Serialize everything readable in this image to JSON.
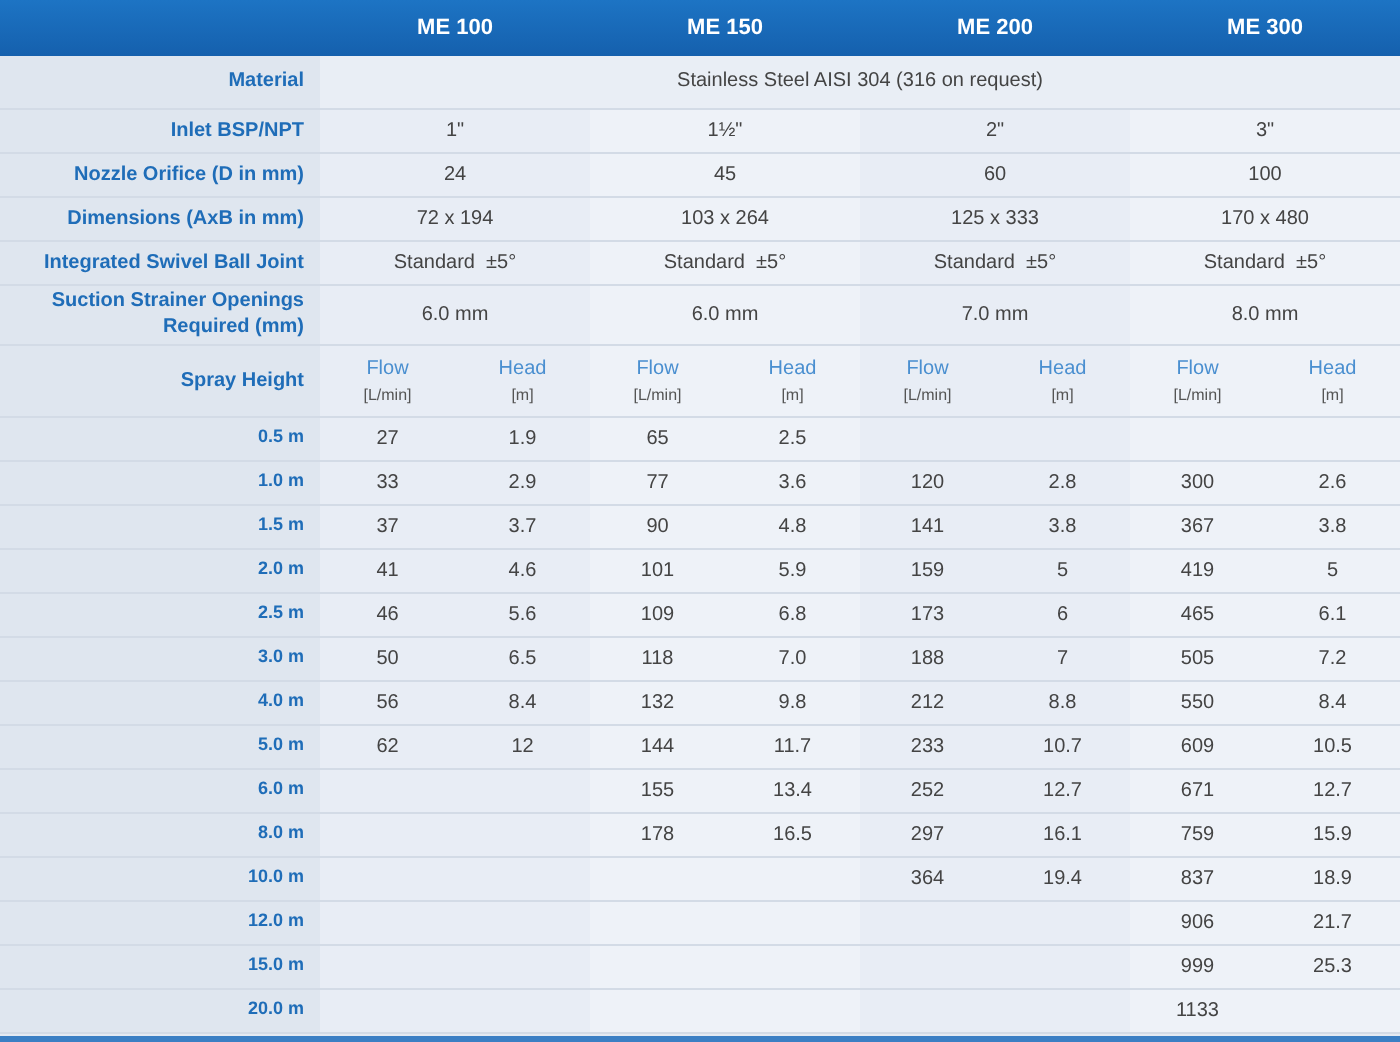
{
  "models": [
    "ME 100",
    "ME 150",
    "ME 200",
    "ME 300"
  ],
  "spec_rows": [
    {
      "label": "Material",
      "values": [
        "Stainless Steel AISI 304 (316 on request)"
      ]
    },
    {
      "label": "Inlet BSP/NPT",
      "values": [
        "1\"",
        "1½\"",
        "2\"",
        "3\""
      ]
    },
    {
      "label": "Nozzle Orifice (D in mm)",
      "values": [
        "24",
        "45",
        "60",
        "100"
      ]
    },
    {
      "label": "Dimensions (AxB in mm)",
      "values": [
        "72 x 194",
        "103 x 264",
        "125 x 333",
        "170 x 480"
      ]
    },
    {
      "label": "Integrated Swivel Ball Joint",
      "values": [
        "Standard  ±5°",
        "Standard  ±5°",
        "Standard  ±5°",
        "Standard  ±5°"
      ]
    },
    {
      "label": "Suction Strainer Openings Required (mm)",
      "values": [
        "6.0 mm",
        "6.0 mm",
        "7.0 mm",
        "8.0 mm"
      ]
    }
  ],
  "spray_header": {
    "label": "Spray Height",
    "columns": [
      {
        "title": "Flow",
        "unit": "[L/min]"
      },
      {
        "title": "Head",
        "unit": "[m]"
      },
      {
        "title": "Flow",
        "unit": "[L/min]"
      },
      {
        "title": "Head",
        "unit": "[m]"
      },
      {
        "title": "Flow",
        "unit": "[L/min]"
      },
      {
        "title": "Head",
        "unit": "[m]"
      },
      {
        "title": "Flow",
        "unit": "[L/min]"
      },
      {
        "title": "Head",
        "unit": "[m]"
      }
    ]
  },
  "spray_rows": [
    {
      "height": "0.5 m",
      "cells": [
        "27",
        "1.9",
        "65",
        "2.5",
        null,
        null,
        null,
        null
      ]
    },
    {
      "height": "1.0 m",
      "cells": [
        "33",
        "2.9",
        "77",
        "3.6",
        "120",
        "2.8",
        "300",
        "2.6"
      ]
    },
    {
      "height": "1.5 m",
      "cells": [
        "37",
        "3.7",
        "90",
        "4.8",
        "141",
        "3.8",
        "367",
        "3.8"
      ]
    },
    {
      "height": "2.0 m",
      "cells": [
        "41",
        "4.6",
        "101",
        "5.9",
        "159",
        "5",
        "419",
        "5"
      ]
    },
    {
      "height": "2.5 m",
      "cells": [
        "46",
        "5.6",
        "109",
        "6.8",
        "173",
        "6",
        "465",
        "6.1"
      ]
    },
    {
      "height": "3.0 m",
      "cells": [
        "50",
        "6.5",
        "118",
        "7.0",
        "188",
        "7",
        "505",
        "7.2"
      ]
    },
    {
      "height": "4.0 m",
      "cells": [
        "56",
        "8.4",
        "132",
        "9.8",
        "212",
        "8.8",
        "550",
        "8.4"
      ]
    },
    {
      "height": "5.0 m",
      "cells": [
        "62",
        "12",
        "144",
        "11.7",
        "233",
        "10.7",
        "609",
        "10.5"
      ]
    },
    {
      "height": "6.0 m",
      "cells": [
        null,
        null,
        "155",
        "13.4",
        "252",
        "12.7",
        "671",
        "12.7"
      ]
    },
    {
      "height": "8.0 m",
      "cells": [
        null,
        null,
        "178",
        "16.5",
        "297",
        "16.1",
        "759",
        "15.9"
      ]
    },
    {
      "height": "10.0 m",
      "cells": [
        null,
        null,
        null,
        null,
        "364",
        "19.4",
        "837",
        "18.9"
      ]
    },
    {
      "height": "12.0 m",
      "cells": [
        null,
        null,
        null,
        null,
        null,
        null,
        "906",
        "21.7"
      ]
    },
    {
      "height": "15.0 m",
      "cells": [
        null,
        null,
        null,
        null,
        null,
        null,
        "999",
        "25.3"
      ]
    },
    {
      "height": "20.0 m",
      "cells": [
        null,
        null,
        null,
        null,
        null,
        null,
        "1133",
        null
      ]
    }
  ]
}
